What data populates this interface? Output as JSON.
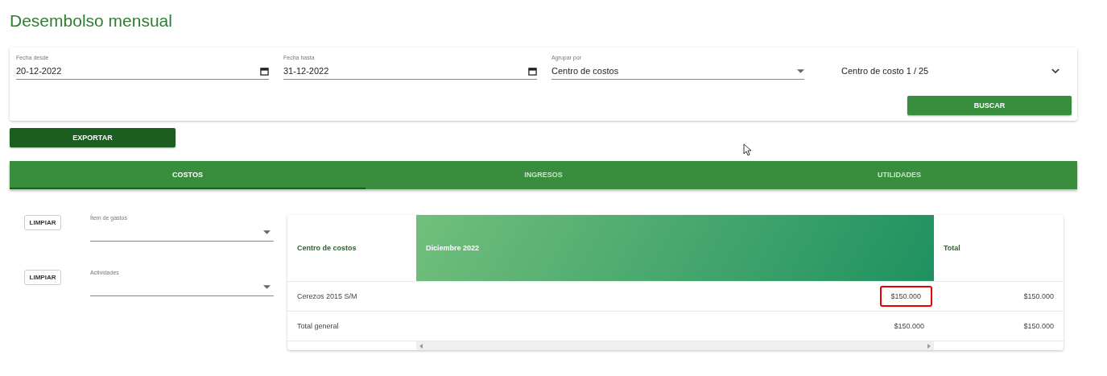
{
  "title": "Desembolso mensual",
  "filters": [
    {
      "kind": "date",
      "label": "Fecha desde",
      "value": "20-12-2022"
    },
    {
      "kind": "date",
      "label": "Fecha hasta",
      "value": "31-12-2022"
    },
    {
      "kind": "select",
      "label": "Agrupar por",
      "value": "Centro de costos"
    },
    {
      "kind": "expand",
      "value": "Centro de costo 1 / 25"
    }
  ],
  "search_button": "BUSCAR",
  "export_button": "EXPORTAR",
  "tabs": [
    {
      "label": "COSTOS",
      "selected": true
    },
    {
      "label": "INGRESOS",
      "selected": false
    },
    {
      "label": "UTILIDADES",
      "selected": false
    }
  ],
  "side_filters": [
    {
      "button": "LIMPIAR",
      "label": "Ítem de gastos"
    },
    {
      "button": "LIMPIAR",
      "label": "Actividades"
    }
  ],
  "table": {
    "columns": [
      "Centro de costos",
      "Diciembre 2022",
      "Total"
    ],
    "rows": [
      {
        "cells": [
          {
            "text": "Cerezos 2015 S/M",
            "highlighted": false
          },
          {
            "text": "$150.000",
            "highlighted": true
          },
          {
            "text": "$150.000",
            "highlighted": false
          }
        ]
      },
      {
        "cells": [
          {
            "text": "Total general",
            "highlighted": false
          },
          {
            "text": "$150.000",
            "highlighted": false
          },
          {
            "text": "$150.000",
            "highlighted": false
          }
        ]
      }
    ]
  }
}
